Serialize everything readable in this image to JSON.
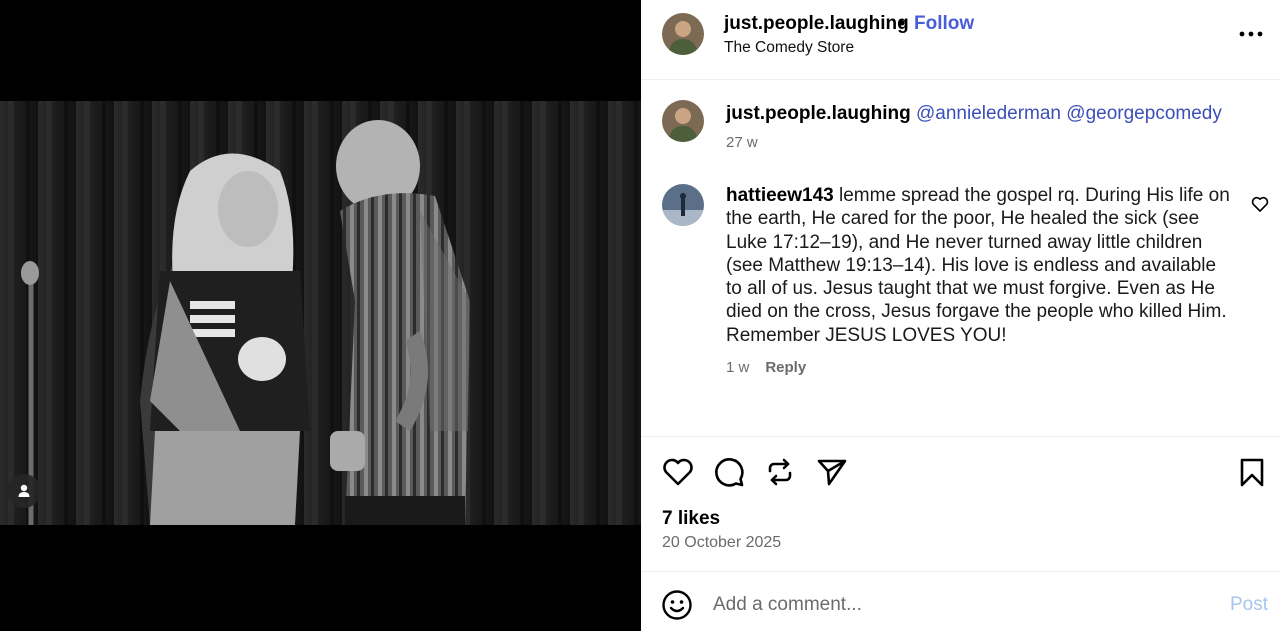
{
  "media": {
    "tag_icon": "user-tag-icon"
  },
  "header": {
    "username": "just.people.laughing",
    "separator": "•",
    "follow_label": "Follow",
    "location": "The Comedy Store",
    "more_icon": "more-horizontal-icon"
  },
  "caption": {
    "username": "just.people.laughing",
    "mention_1": "@annielederman",
    "mention_2": "@georgepcomedy",
    "time": "27 w"
  },
  "comment": {
    "username": "hattieew143",
    "text": "lemme spread the gospel rq. During His life on the earth, He cared for the poor, He healed the sick (see Luke 17:12–19), and He never turned away little children (see Matthew 19:13–14). His love is endless and available to all of us. Jesus taught that we must forgive. Even as He died on the cross, Jesus forgave the people who killed Him. Remember JESUS LOVES YOU!",
    "time": "1 w",
    "reply_label": "Reply",
    "like_icon": "heart-outline-icon"
  },
  "actions": {
    "icons": [
      "heart-icon",
      "comment-icon",
      "repost-icon",
      "share-icon",
      "bookmark-icon"
    ],
    "likes": "7 likes",
    "date": "20 October 2025"
  },
  "composer": {
    "emoji_icon": "emoji-icon",
    "placeholder": "Add a comment...",
    "post_label": "Post",
    "post_color": "#a8c5f0"
  },
  "colors": {
    "link_blue": "#4a5dd8",
    "mention_blue": "#3b4fb8",
    "muted": "#6b6b6b"
  }
}
